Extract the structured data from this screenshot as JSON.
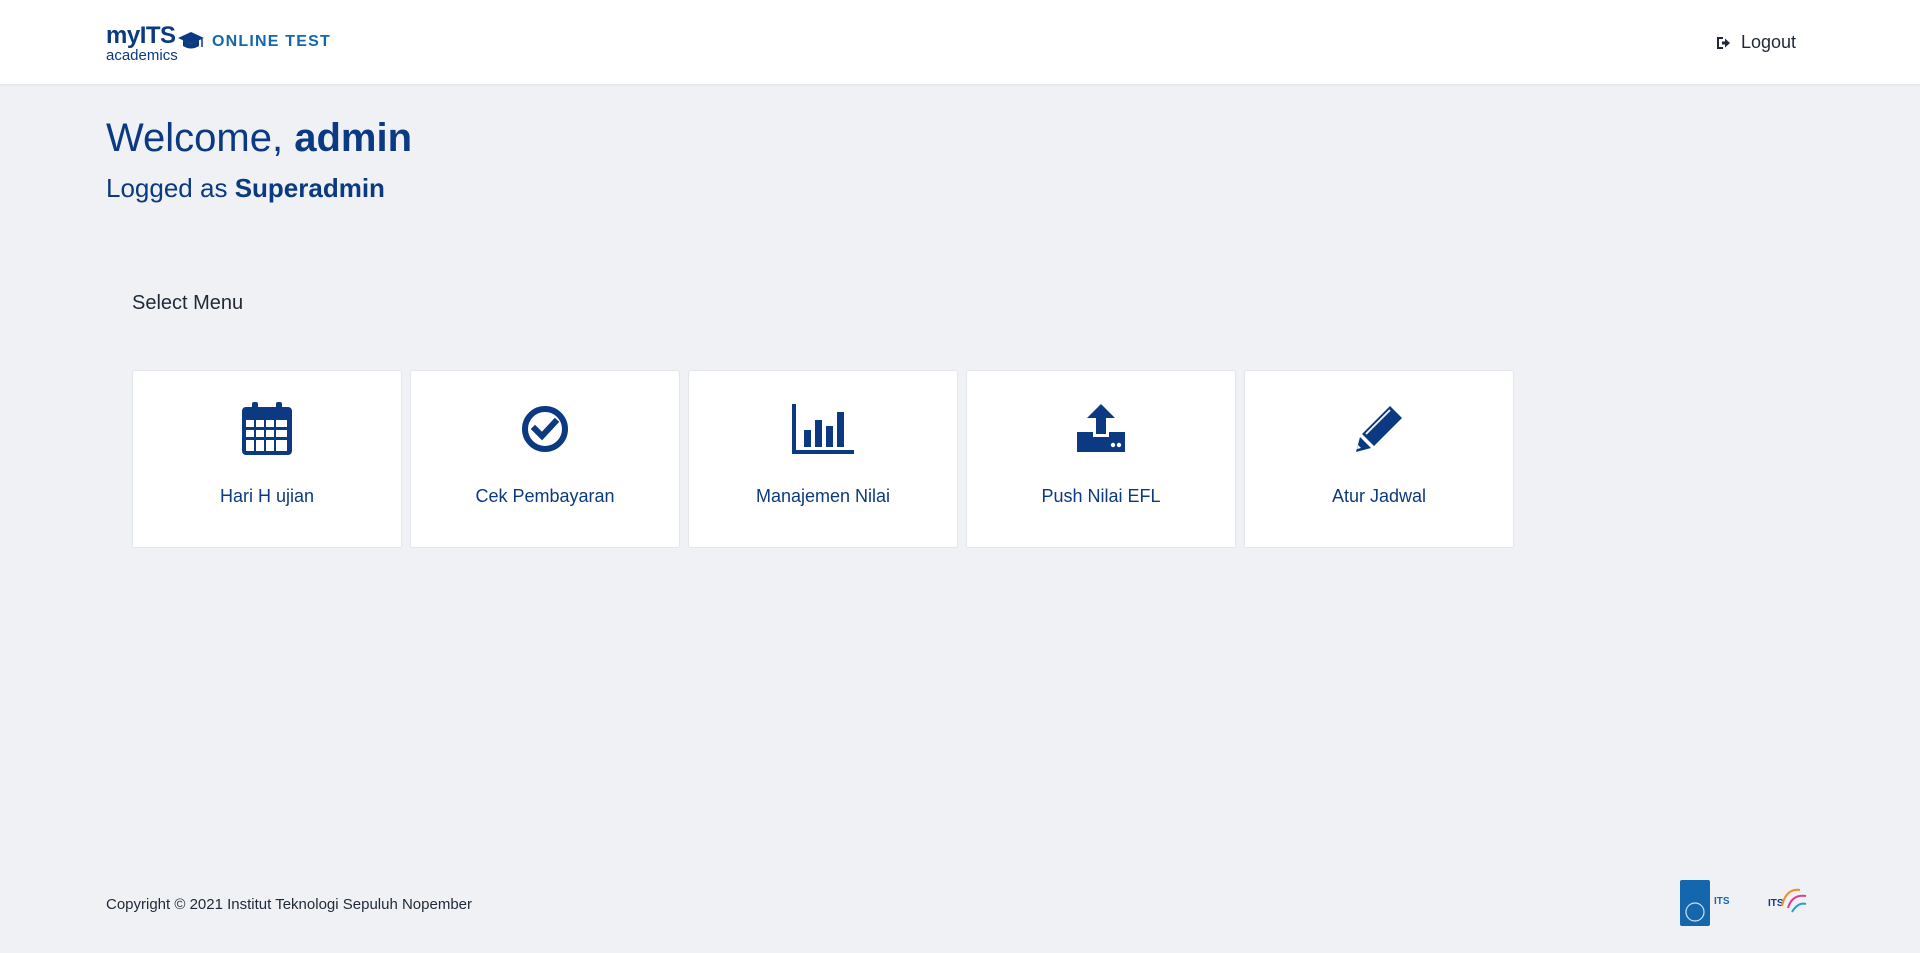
{
  "header": {
    "logo": {
      "top": "myITS",
      "bottom": "academics"
    },
    "app_name": "ONLINE TEST",
    "logout_label": "Logout"
  },
  "welcome": {
    "greeting": "Welcome,",
    "username": "admin",
    "logged_as_prefix": "Logged as",
    "role": "Superadmin"
  },
  "menu": {
    "heading": "Select Menu",
    "items": [
      {
        "label": "Hari H ujian",
        "icon": "calendar-icon"
      },
      {
        "label": "Cek Pembayaran",
        "icon": "check-circle-icon"
      },
      {
        "label": "Manajemen Nilai",
        "icon": "bar-chart-icon"
      },
      {
        "label": "Push Nilai EFL",
        "icon": "upload-icon"
      },
      {
        "label": "Atur Jadwal",
        "icon": "pencil-icon"
      }
    ]
  },
  "footer": {
    "copyright": "Copyright © 2021 Institut Teknologi Sepuluh Nopember",
    "logo1_text": "ITS",
    "logo2_text": "ITS"
  },
  "colors": {
    "primary": "#0b3a82",
    "accent": "#1467ad",
    "background": "#eff1f5",
    "card": "#ffffff"
  }
}
